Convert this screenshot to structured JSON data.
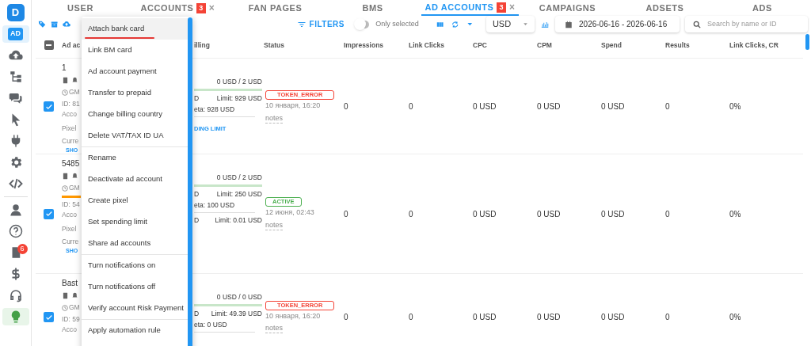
{
  "sidebar": {
    "logo": "D",
    "items": [
      {
        "label": "AD",
        "selected": true
      },
      {
        "selected": false
      },
      {
        "selected": false
      },
      {
        "selected": false
      },
      {
        "selected": false
      },
      {
        "selected": false
      },
      {
        "selected": false
      },
      {
        "selected": false
      },
      {
        "selected": false
      },
      {
        "selected": false
      },
      {
        "selected": false,
        "badge": "6"
      },
      {
        "selected": false
      },
      {
        "selected": false
      },
      {
        "selected": true
      }
    ]
  },
  "tabs": [
    {
      "label": "USER",
      "selected": false
    },
    {
      "label": "ACCOUNTS",
      "selected": false,
      "badge": "3",
      "close": "×"
    },
    {
      "label": "FAN PAGES",
      "selected": false
    },
    {
      "label": "BMS",
      "selected": false
    },
    {
      "label": "AD ACCOUNTS",
      "selected": true,
      "badge": "3",
      "close": "×"
    },
    {
      "label": "CAMPAIGNS",
      "selected": false
    },
    {
      "label": "ADSETS",
      "selected": false
    },
    {
      "label": "ADS",
      "selected": false
    }
  ],
  "toolbar": {
    "filters": "FILTERS",
    "only_selected": {
      "label": "Only selected",
      "on": false
    },
    "currency": "USD",
    "date_range": "2026-06-16 - 2026-06-16",
    "search": {
      "placeholder": "Search by name or ID"
    }
  },
  "table": {
    "select_all": {
      "indeterminate": true
    },
    "columns": [
      "Ad ac",
      "illing",
      "Status",
      "Impressions",
      "Link Clicks",
      "CPC",
      "CPM",
      "Spend",
      "Results",
      "Link Clicks, CR"
    ],
    "rows": [
      {
        "checked": true,
        "account": {
          "name": "1",
          "tz": "GM",
          "id": "ID: 81",
          "acc": "Acco",
          "pixel": "Pixel",
          "currency": "Curre",
          "link": "SHO",
          "warning": false
        },
        "billing": {
          "spent": "0 USD / 2 USD",
          "limit_left": "D",
          "limit": "Limit: 929 USD",
          "meta": "eta: 928 USD",
          "action": "DING LIMIT"
        },
        "status": {
          "label": "TOKEN_ERROR",
          "kind": "error"
        },
        "date": "10 января, 16:20",
        "notes": "notes",
        "metrics": [
          "0",
          "0",
          "0 USD",
          "0 USD",
          "0 USD",
          "0",
          "0%"
        ]
      },
      {
        "checked": true,
        "account": {
          "name": "5485",
          "tz": "GM",
          "id": "ID: 54",
          "acc": "Acco",
          "pixel": "Pixel",
          "currency": "Curre",
          "link": "SHO",
          "warning": true
        },
        "billing": {
          "spent": "0 USD / 2 USD",
          "limit_left": "D",
          "limit": "Limit: 250 USD",
          "meta": "eta: 100 USD",
          "extra_left": "D",
          "extra": "Limit: 0.01 USD"
        },
        "status": {
          "label": "ACTIVE",
          "kind": "active"
        },
        "date": "12 июня, 02:43",
        "notes": "notes",
        "metrics": [
          "0",
          "0",
          "0 USD",
          "0 USD",
          "0 USD",
          "0",
          "0%"
        ]
      },
      {
        "checked": true,
        "account": {
          "name": "Bast",
          "tz": "GM",
          "id": "ID: 59",
          "acc": "Acco",
          "warning": false
        },
        "billing": {
          "spent": "0 USD / 0 USD",
          "limit_left": "D",
          "limit": "Limit: 49.39 USD",
          "meta": "eta: 0 USD"
        },
        "status": {
          "label": "TOKEN_ERROR",
          "kind": "error"
        },
        "date": "10 января, 16:20",
        "notes": "notes",
        "metrics": [
          "0",
          "0",
          "0 USD",
          "0 USD",
          "0 USD",
          "0",
          "0%"
        ]
      }
    ]
  },
  "context_menu": {
    "groups": [
      [
        {
          "label": "Attach bank card",
          "selected": true
        },
        {
          "label": "Link BM card",
          "selected": false
        },
        {
          "label": "Ad account payment",
          "selected": false
        },
        {
          "label": "Transfer to prepaid",
          "selected": false
        },
        {
          "label": "Change billing country",
          "selected": false
        },
        {
          "label": "Delete VAT/TAX ID UA",
          "selected": false
        }
      ],
      [
        {
          "label": "Rename",
          "selected": false
        },
        {
          "label": "Deactivate ad account",
          "selected": false
        },
        {
          "label": "Create pixel",
          "selected": false
        },
        {
          "label": "Set spending limit",
          "selected": false
        },
        {
          "label": "Share ad accounts",
          "selected": false
        }
      ],
      [
        {
          "label": "Turn notifications on",
          "selected": false
        },
        {
          "label": "Turn notifications off",
          "selected": false
        },
        {
          "label": "Verify account Risk Payment",
          "selected": false
        }
      ],
      [
        {
          "label": "Apply automation rule",
          "selected": false
        }
      ]
    ]
  }
}
